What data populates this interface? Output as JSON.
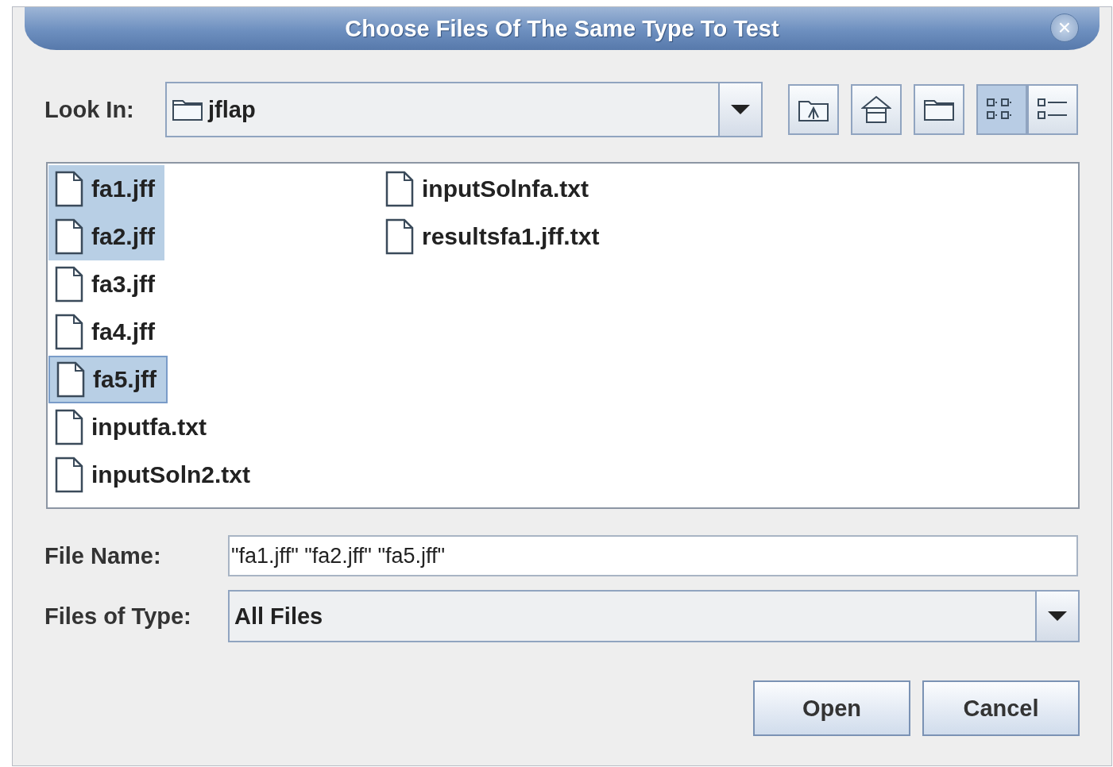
{
  "window": {
    "title": "Choose Files Of The Same Type To Test",
    "close": "×"
  },
  "look_in": {
    "label": "Look In:",
    "value": "jflap"
  },
  "toolbar": [
    {
      "kind": "up",
      "selected": false
    },
    {
      "kind": "home",
      "selected": false
    },
    {
      "kind": "new-folder",
      "selected": false
    },
    {
      "kind": "list-view",
      "selected": true
    },
    {
      "kind": "details-view",
      "selected": false
    }
  ],
  "files": [
    {
      "name": "fa1.jff",
      "selected": true,
      "focused": false
    },
    {
      "name": "fa2.jff",
      "selected": true,
      "focused": false
    },
    {
      "name": "fa3.jff",
      "selected": false,
      "focused": false
    },
    {
      "name": "fa4.jff",
      "selected": false,
      "focused": false
    },
    {
      "name": "fa5.jff",
      "selected": true,
      "focused": true
    },
    {
      "name": "inputfa.txt",
      "selected": false,
      "focused": false
    },
    {
      "name": "inputSoln2.txt",
      "selected": false,
      "focused": false
    },
    {
      "name": "inputSolnfa.txt",
      "selected": false,
      "focused": false
    },
    {
      "name": "resultsfa1.jff.txt",
      "selected": false,
      "focused": false
    }
  ],
  "file_name": {
    "label": "File Name:",
    "value": "\"fa1.jff\" \"fa2.jff\" \"fa5.jff\""
  },
  "file_type": {
    "label": "Files of Type:",
    "value": "All Files"
  },
  "buttons": [
    "Open",
    "Cancel"
  ]
}
